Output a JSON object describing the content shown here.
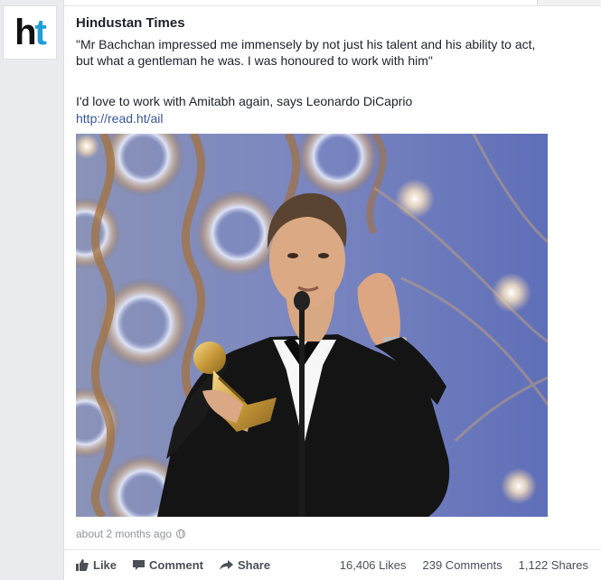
{
  "page": {
    "name": "Hindustan Times",
    "logo_text_h": "h",
    "logo_text_t": "t"
  },
  "post": {
    "quote": "\"Mr Bachchan impressed me immensely by not just his talent and his ability to act, but what a gentleman he was. I was honoured to work with him\"",
    "headline": "I'd love to work with Amitabh again, says Leonardo DiCaprio",
    "link": "http://read.ht/ail",
    "timestamp": "about 2 months ago"
  },
  "actions": {
    "like": "Like",
    "comment": "Comment",
    "share": "Share"
  },
  "stats": {
    "likes": "16,406 Likes",
    "comments": "239 Comments",
    "shares": "1,122 Shares"
  },
  "colors": {
    "brand_blue": "#1e9ed8",
    "link_blue": "#365899",
    "text": "#1d2129",
    "muted": "#90949c"
  },
  "icons": {
    "like": "thumbs-up-icon",
    "comment": "speech-bubble-icon",
    "share": "share-arrow-icon",
    "privacy": "globe-icon"
  }
}
